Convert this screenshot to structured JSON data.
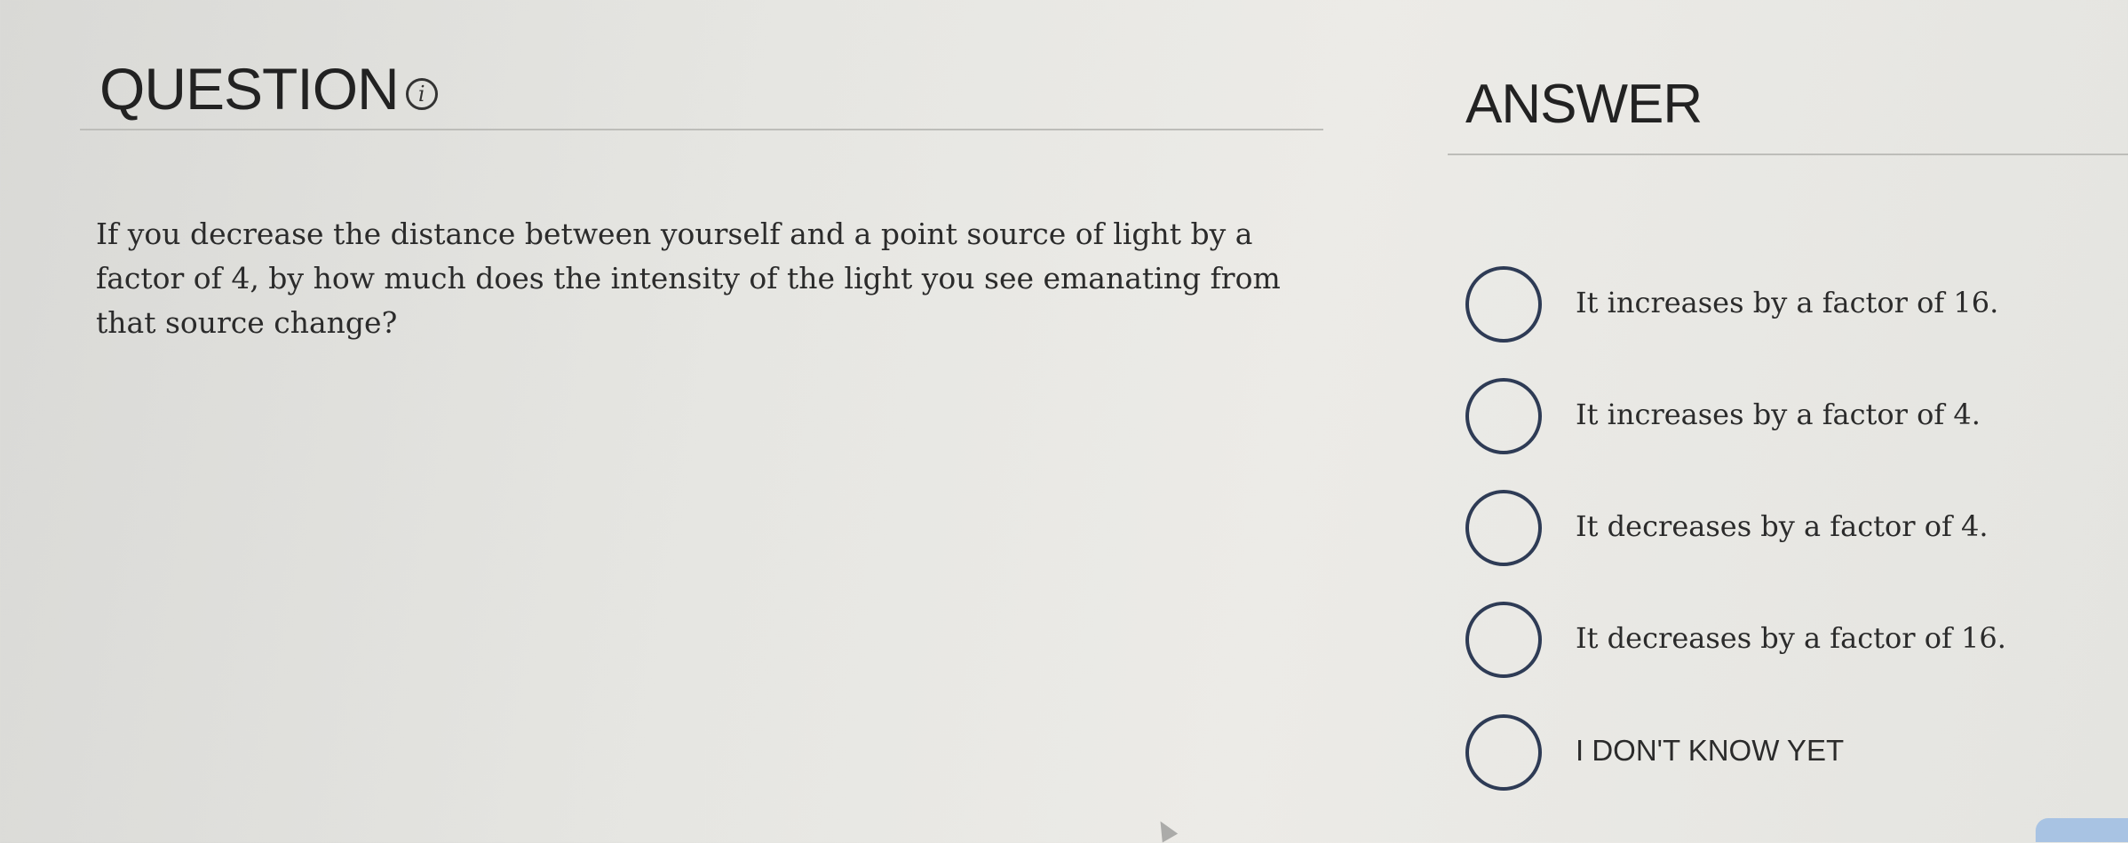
{
  "question": {
    "title": "QUESTION",
    "info_symbol": "i",
    "text": "If you decrease the distance between yourself and a point source of light by a factor of 4, by how much does the intensity of the light you see emanating from that source change?"
  },
  "answer": {
    "title": "ANSWER",
    "options": [
      {
        "label": "It increases by a factor of 16."
      },
      {
        "label": "It increases by a factor of 4."
      },
      {
        "label": "It decreases by a factor of 4."
      },
      {
        "label": "It decreases by a factor of 16."
      },
      {
        "label": "I DON'T KNOW YET"
      }
    ]
  },
  "colors": {
    "radio_border": "#2e3b55",
    "corner_button": "#a8c3e3"
  },
  "icons": {
    "info": "info-icon"
  }
}
